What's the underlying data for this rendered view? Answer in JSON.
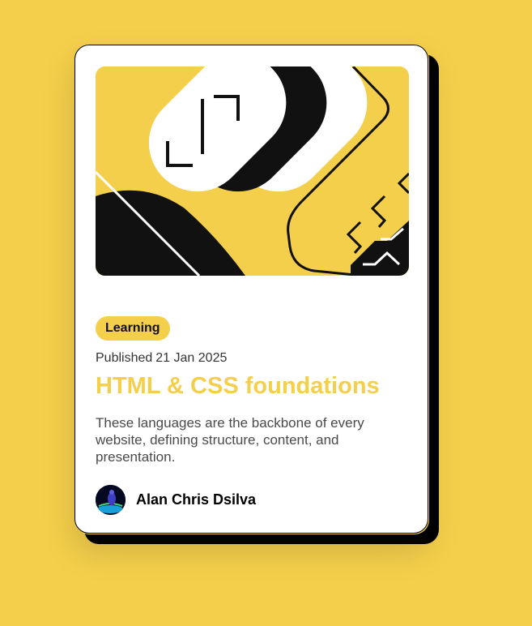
{
  "card": {
    "tag": "Learning",
    "published_label": "Published",
    "published_date": "21 Jan 2025",
    "title": "HTML & CSS foundations",
    "description": "These languages are the backbone of every website, defining structure, content, and presentation.",
    "author": "Alan Chris Dsilva"
  },
  "colors": {
    "background": "#f4cf4b",
    "accent": "#f4cf4b",
    "card": "#ffffff",
    "ink": "#111111"
  },
  "icons": {
    "hero": "abstract-illustration",
    "avatar": "author-avatar"
  }
}
